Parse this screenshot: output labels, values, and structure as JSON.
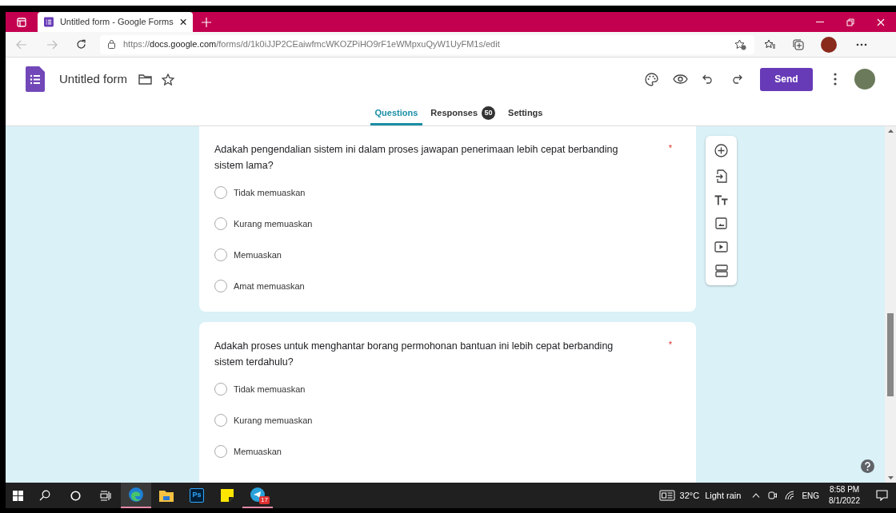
{
  "browser": {
    "tab_title": "Untitled form - Google Forms",
    "url_prefix": "https://",
    "url_host": "docs.google.com",
    "url_path": "/forms/d/1k0iJJP2CEaiwfmcWKOZPiHO9rF1eWMpxuQyW1UyFM1s/edit"
  },
  "form": {
    "title": "Untitled form",
    "send_label": "Send"
  },
  "tabs": [
    {
      "label": "Questions",
      "selected": true
    },
    {
      "label": "Responses",
      "selected": false,
      "badge": "50"
    },
    {
      "label": "Settings",
      "selected": false
    }
  ],
  "questions": [
    {
      "text": "Adakah pengendalian sistem ini dalam proses jawapan penerimaan lebih cepat berbanding sistem lama?",
      "required_mark": "*",
      "options": [
        {
          "label": "Tidak memuaskan",
          "selected": false
        },
        {
          "label": "Kurang memuaskan",
          "selected": false
        },
        {
          "label": "Memuaskan",
          "selected": false
        },
        {
          "label": "Amat memuaskan",
          "selected": false
        }
      ]
    },
    {
      "text": "Adakah proses untuk menghantar borang permohonan bantuan ini lebih cepat berbanding sistem terdahulu?",
      "required_mark": "*",
      "options": [
        {
          "label": "Tidak memuaskan",
          "selected": false
        },
        {
          "label": "Kurang memuaskan",
          "selected": false
        },
        {
          "label": "Memuaskan",
          "selected": false
        }
      ]
    }
  ],
  "taskbar": {
    "photoshop_label": "Ps",
    "telegram_badge": "17",
    "weather_temp": "32°C",
    "weather_text": "Light rain",
    "language": "ENG",
    "time": "8:58 PM",
    "date": "8/1/2022"
  }
}
